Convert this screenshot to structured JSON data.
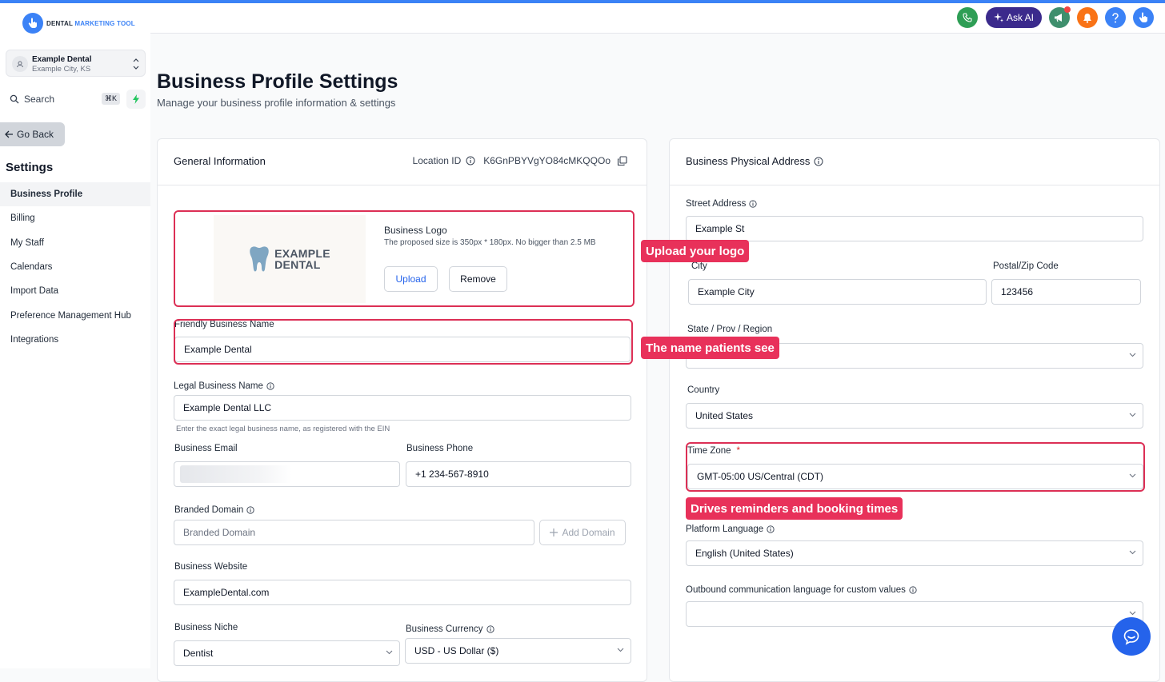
{
  "app": {
    "logo_line1": "DENTAL",
    "logo_line2": "MARKETING TOOL"
  },
  "location": {
    "name": "Example Dental",
    "city": "Example City, KS"
  },
  "search": {
    "label": "Search",
    "shortcut": "⌘K"
  },
  "sidebar": {
    "go_back": "Go Back",
    "section_title": "Settings",
    "items": [
      {
        "label": "Business Profile",
        "active": true
      },
      {
        "label": "Billing"
      },
      {
        "label": "My Staff"
      },
      {
        "label": "Calendars"
      },
      {
        "label": "Import Data"
      },
      {
        "label": "Preference Management Hub"
      },
      {
        "label": "Integrations"
      }
    ]
  },
  "header": {
    "ask_ai": "Ask AI"
  },
  "page": {
    "title": "Business Profile Settings",
    "subtitle": "Manage your business profile information & settings"
  },
  "general": {
    "title": "General Information",
    "location_id_label": "Location ID",
    "location_id_value": "K6GnPBYVgYO84cMKQQOo",
    "logo": {
      "brand_line1": "EXAMPLE",
      "brand_line2": "DENTAL",
      "title": "Business Logo",
      "hint": "The proposed size is 350px * 180px. No bigger than 2.5 MB",
      "upload": "Upload",
      "remove": "Remove"
    },
    "friendly_name": {
      "label": "Friendly Business Name",
      "value": "Example Dental"
    },
    "legal_name": {
      "label": "Legal Business Name",
      "value": "Example Dental LLC",
      "hint": "Enter the exact legal business name, as registered with the EIN"
    },
    "email": {
      "label": "Business Email",
      "value": ""
    },
    "phone": {
      "label": "Business Phone",
      "value": "+1 234-567-8910"
    },
    "domain": {
      "label": "Branded Domain",
      "placeholder": "Branded Domain",
      "add": "Add Domain"
    },
    "website": {
      "label": "Business Website",
      "value": "ExampleDental.com"
    },
    "niche": {
      "label": "Business Niche",
      "value": "Dentist"
    },
    "currency": {
      "label": "Business Currency",
      "value": "USD - US Dollar ($)"
    }
  },
  "address": {
    "title": "Business Physical Address",
    "street": {
      "label": "Street Address",
      "value": "Example St"
    },
    "city": {
      "label": "City",
      "value": "Example City"
    },
    "zip": {
      "label": "Postal/Zip Code",
      "value": "123456"
    },
    "state": {
      "label": "State / Prov / Region",
      "value": ""
    },
    "country": {
      "label": "Country",
      "value": "United States"
    },
    "timezone": {
      "label": "Time Zone",
      "required": "*",
      "value": "GMT-05:00 US/Central (CDT)"
    },
    "language": {
      "label": "Platform Language",
      "value": "English (United States)"
    },
    "outbound": {
      "label": "Outbound communication language for custom values",
      "value": ""
    }
  },
  "callouts": {
    "logo": "Upload your logo",
    "name": "The name patients see",
    "timezone": "Drives reminders and booking times"
  },
  "colors": {
    "accent": "#3b82f6",
    "highlight": "#dc2f55",
    "callout": "#e8315a"
  }
}
